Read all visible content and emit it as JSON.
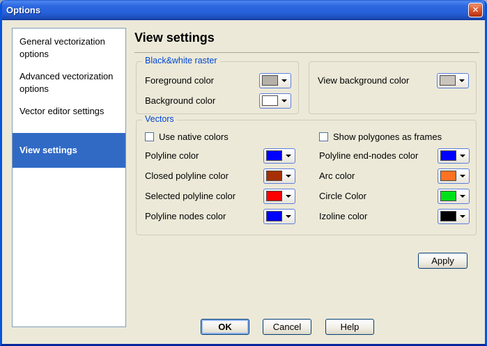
{
  "window": {
    "title": "Options",
    "close_label": "✕"
  },
  "sidebar": {
    "items": [
      {
        "label": "General vectorization options",
        "selected": false
      },
      {
        "label": "Advanced vectorization options",
        "selected": false
      },
      {
        "label": "Vector editor settings",
        "selected": false
      },
      {
        "label": "View settings",
        "selected": true
      }
    ]
  },
  "header": {
    "title": "View settings"
  },
  "bw_raster": {
    "title": "Black&white raster",
    "rows": [
      {
        "label": "Foreground color",
        "color": "#b5b1a8"
      },
      {
        "label": "Background color",
        "color": "#ffffff"
      }
    ]
  },
  "view_background": {
    "rows": [
      {
        "label": "View background color",
        "color": "#c9c5bc"
      }
    ]
  },
  "vectors": {
    "title": "Vectors",
    "left": {
      "checkbox_label": "Use native colors",
      "checkbox_checked": false,
      "rows": [
        {
          "label": "Polyline color",
          "color": "#0000ff"
        },
        {
          "label": "Closed polyline color",
          "color": "#a53005"
        },
        {
          "label": "Selected polyline color",
          "color": "#ff0000"
        },
        {
          "label": "Polyline nodes color",
          "color": "#0000ff"
        }
      ]
    },
    "right": {
      "checkbox_label": "Show polygones as frames",
      "checkbox_checked": false,
      "rows": [
        {
          "label": "Polyline end-nodes color",
          "color": "#0000ff"
        },
        {
          "label": "Arc color",
          "color": "#ff7221"
        },
        {
          "label": "Circle Color",
          "color": "#00e01a"
        },
        {
          "label": "Izoline color",
          "color": "#000000"
        }
      ]
    }
  },
  "buttons": {
    "apply": "Apply",
    "ok": "OK",
    "cancel": "Cancel",
    "help": "Help"
  },
  "colors": {
    "titlebar": "#2b63de",
    "selection": "#316ac5",
    "group_label": "#0046d5",
    "dialog_face": "#ece9d8"
  }
}
